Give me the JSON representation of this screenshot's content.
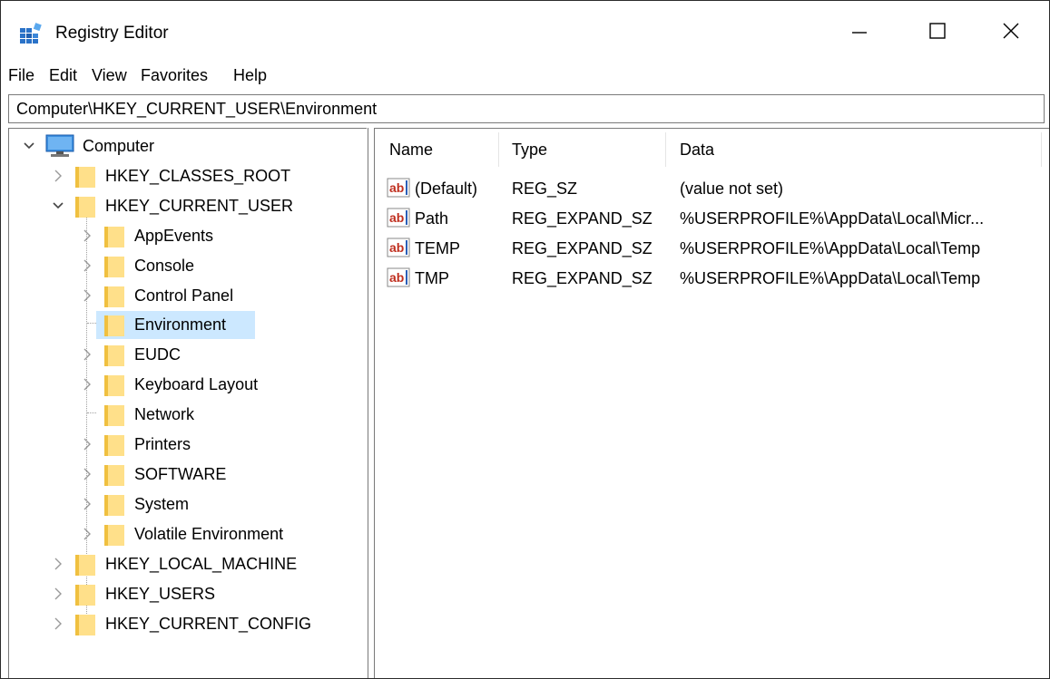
{
  "window": {
    "title": "Registry Editor",
    "icon": "registry-editor-icon",
    "controls": {
      "minimize": "minimize-icon",
      "maximize": "maximize-icon",
      "close": "close-icon"
    }
  },
  "menu": [
    "File",
    "Edit",
    "View",
    "Favorites",
    "Help"
  ],
  "address": "Computer\\HKEY_CURRENT_USER\\Environment",
  "tree": {
    "root": "Computer",
    "items": [
      {
        "label": "HKEY_CLASSES_ROOT",
        "expanded": false
      },
      {
        "label": "HKEY_CURRENT_USER",
        "expanded": true
      },
      {
        "label": "AppEvents"
      },
      {
        "label": "Console"
      },
      {
        "label": "Control Panel"
      },
      {
        "label": "Environment",
        "selected": true
      },
      {
        "label": "EUDC"
      },
      {
        "label": "Keyboard Layout"
      },
      {
        "label": "Network"
      },
      {
        "label": "Printers"
      },
      {
        "label": "SOFTWARE"
      },
      {
        "label": "System"
      },
      {
        "label": "Volatile Environment"
      },
      {
        "label": "HKEY_LOCAL_MACHINE",
        "expanded": false
      },
      {
        "label": "HKEY_USERS",
        "expanded": false
      },
      {
        "label": "HKEY_CURRENT_CONFIG",
        "expanded": false
      }
    ]
  },
  "list": {
    "columns": [
      "Name",
      "Type",
      "Data"
    ],
    "rows": [
      {
        "name": "(Default)",
        "type": "REG_SZ",
        "data": "(value not set)"
      },
      {
        "name": "Path",
        "type": "REG_EXPAND_SZ",
        "data": "%USERPROFILE%\\AppData\\Local\\Micr..."
      },
      {
        "name": "TEMP",
        "type": "REG_EXPAND_SZ",
        "data": "%USERPROFILE%\\AppData\\Local\\Temp"
      },
      {
        "name": "TMP",
        "type": "REG_EXPAND_SZ",
        "data": "%USERPROFILE%\\AppData\\Local\\Temp"
      }
    ]
  },
  "colors": {
    "selection": "#cce8ff",
    "folder": "#ffe08a",
    "folder_tab": "#f0c040",
    "string_icon_red": "#c03020",
    "string_icon_blue": "#2a5fb8"
  }
}
